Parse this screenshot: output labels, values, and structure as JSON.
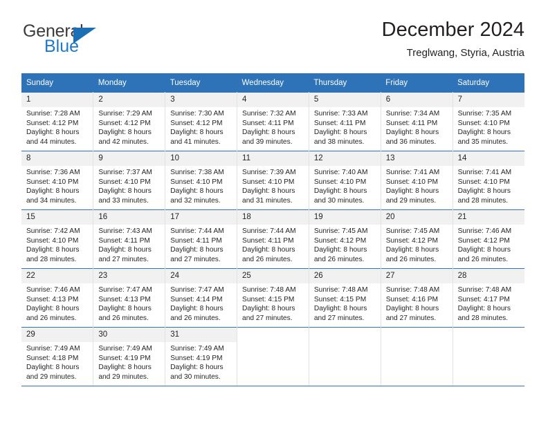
{
  "brand": {
    "name_top": "General",
    "name_bottom": "Blue",
    "triangle_color": "#1b6fb5",
    "text_color": "#3b3b3b",
    "blue_color": "#2079c8"
  },
  "header": {
    "title": "December 2024",
    "subtitle": "Treglwang, Styria, Austria"
  },
  "theme": {
    "header_bg": "#2e72b8",
    "header_text": "#ffffff",
    "daynum_bg": "#f1f1f1",
    "cell_border": "#e2e2e2",
    "week_border": "#2e72b8",
    "text": "#231f20"
  },
  "weekday_headers": [
    "Sunday",
    "Monday",
    "Tuesday",
    "Wednesday",
    "Thursday",
    "Friday",
    "Saturday"
  ],
  "weeks": [
    [
      {
        "day": "1",
        "sunrise": "Sunrise: 7:28 AM",
        "sunset": "Sunset: 4:12 PM",
        "daylight_line1": "Daylight: 8 hours",
        "daylight_line2": "and 44 minutes."
      },
      {
        "day": "2",
        "sunrise": "Sunrise: 7:29 AM",
        "sunset": "Sunset: 4:12 PM",
        "daylight_line1": "Daylight: 8 hours",
        "daylight_line2": "and 42 minutes."
      },
      {
        "day": "3",
        "sunrise": "Sunrise: 7:30 AM",
        "sunset": "Sunset: 4:12 PM",
        "daylight_line1": "Daylight: 8 hours",
        "daylight_line2": "and 41 minutes."
      },
      {
        "day": "4",
        "sunrise": "Sunrise: 7:32 AM",
        "sunset": "Sunset: 4:11 PM",
        "daylight_line1": "Daylight: 8 hours",
        "daylight_line2": "and 39 minutes."
      },
      {
        "day": "5",
        "sunrise": "Sunrise: 7:33 AM",
        "sunset": "Sunset: 4:11 PM",
        "daylight_line1": "Daylight: 8 hours",
        "daylight_line2": "and 38 minutes."
      },
      {
        "day": "6",
        "sunrise": "Sunrise: 7:34 AM",
        "sunset": "Sunset: 4:11 PM",
        "daylight_line1": "Daylight: 8 hours",
        "daylight_line2": "and 36 minutes."
      },
      {
        "day": "7",
        "sunrise": "Sunrise: 7:35 AM",
        "sunset": "Sunset: 4:10 PM",
        "daylight_line1": "Daylight: 8 hours",
        "daylight_line2": "and 35 minutes."
      }
    ],
    [
      {
        "day": "8",
        "sunrise": "Sunrise: 7:36 AM",
        "sunset": "Sunset: 4:10 PM",
        "daylight_line1": "Daylight: 8 hours",
        "daylight_line2": "and 34 minutes."
      },
      {
        "day": "9",
        "sunrise": "Sunrise: 7:37 AM",
        "sunset": "Sunset: 4:10 PM",
        "daylight_line1": "Daylight: 8 hours",
        "daylight_line2": "and 33 minutes."
      },
      {
        "day": "10",
        "sunrise": "Sunrise: 7:38 AM",
        "sunset": "Sunset: 4:10 PM",
        "daylight_line1": "Daylight: 8 hours",
        "daylight_line2": "and 32 minutes."
      },
      {
        "day": "11",
        "sunrise": "Sunrise: 7:39 AM",
        "sunset": "Sunset: 4:10 PM",
        "daylight_line1": "Daylight: 8 hours",
        "daylight_line2": "and 31 minutes."
      },
      {
        "day": "12",
        "sunrise": "Sunrise: 7:40 AM",
        "sunset": "Sunset: 4:10 PM",
        "daylight_line1": "Daylight: 8 hours",
        "daylight_line2": "and 30 minutes."
      },
      {
        "day": "13",
        "sunrise": "Sunrise: 7:41 AM",
        "sunset": "Sunset: 4:10 PM",
        "daylight_line1": "Daylight: 8 hours",
        "daylight_line2": "and 29 minutes."
      },
      {
        "day": "14",
        "sunrise": "Sunrise: 7:41 AM",
        "sunset": "Sunset: 4:10 PM",
        "daylight_line1": "Daylight: 8 hours",
        "daylight_line2": "and 28 minutes."
      }
    ],
    [
      {
        "day": "15",
        "sunrise": "Sunrise: 7:42 AM",
        "sunset": "Sunset: 4:10 PM",
        "daylight_line1": "Daylight: 8 hours",
        "daylight_line2": "and 28 minutes."
      },
      {
        "day": "16",
        "sunrise": "Sunrise: 7:43 AM",
        "sunset": "Sunset: 4:11 PM",
        "daylight_line1": "Daylight: 8 hours",
        "daylight_line2": "and 27 minutes."
      },
      {
        "day": "17",
        "sunrise": "Sunrise: 7:44 AM",
        "sunset": "Sunset: 4:11 PM",
        "daylight_line1": "Daylight: 8 hours",
        "daylight_line2": "and 27 minutes."
      },
      {
        "day": "18",
        "sunrise": "Sunrise: 7:44 AM",
        "sunset": "Sunset: 4:11 PM",
        "daylight_line1": "Daylight: 8 hours",
        "daylight_line2": "and 26 minutes."
      },
      {
        "day": "19",
        "sunrise": "Sunrise: 7:45 AM",
        "sunset": "Sunset: 4:12 PM",
        "daylight_line1": "Daylight: 8 hours",
        "daylight_line2": "and 26 minutes."
      },
      {
        "day": "20",
        "sunrise": "Sunrise: 7:45 AM",
        "sunset": "Sunset: 4:12 PM",
        "daylight_line1": "Daylight: 8 hours",
        "daylight_line2": "and 26 minutes."
      },
      {
        "day": "21",
        "sunrise": "Sunrise: 7:46 AM",
        "sunset": "Sunset: 4:12 PM",
        "daylight_line1": "Daylight: 8 hours",
        "daylight_line2": "and 26 minutes."
      }
    ],
    [
      {
        "day": "22",
        "sunrise": "Sunrise: 7:46 AM",
        "sunset": "Sunset: 4:13 PM",
        "daylight_line1": "Daylight: 8 hours",
        "daylight_line2": "and 26 minutes."
      },
      {
        "day": "23",
        "sunrise": "Sunrise: 7:47 AM",
        "sunset": "Sunset: 4:13 PM",
        "daylight_line1": "Daylight: 8 hours",
        "daylight_line2": "and 26 minutes."
      },
      {
        "day": "24",
        "sunrise": "Sunrise: 7:47 AM",
        "sunset": "Sunset: 4:14 PM",
        "daylight_line1": "Daylight: 8 hours",
        "daylight_line2": "and 26 minutes."
      },
      {
        "day": "25",
        "sunrise": "Sunrise: 7:48 AM",
        "sunset": "Sunset: 4:15 PM",
        "daylight_line1": "Daylight: 8 hours",
        "daylight_line2": "and 27 minutes."
      },
      {
        "day": "26",
        "sunrise": "Sunrise: 7:48 AM",
        "sunset": "Sunset: 4:15 PM",
        "daylight_line1": "Daylight: 8 hours",
        "daylight_line2": "and 27 minutes."
      },
      {
        "day": "27",
        "sunrise": "Sunrise: 7:48 AM",
        "sunset": "Sunset: 4:16 PM",
        "daylight_line1": "Daylight: 8 hours",
        "daylight_line2": "and 27 minutes."
      },
      {
        "day": "28",
        "sunrise": "Sunrise: 7:48 AM",
        "sunset": "Sunset: 4:17 PM",
        "daylight_line1": "Daylight: 8 hours",
        "daylight_line2": "and 28 minutes."
      }
    ],
    [
      {
        "day": "29",
        "sunrise": "Sunrise: 7:49 AM",
        "sunset": "Sunset: 4:18 PM",
        "daylight_line1": "Daylight: 8 hours",
        "daylight_line2": "and 29 minutes."
      },
      {
        "day": "30",
        "sunrise": "Sunrise: 7:49 AM",
        "sunset": "Sunset: 4:19 PM",
        "daylight_line1": "Daylight: 8 hours",
        "daylight_line2": "and 29 minutes."
      },
      {
        "day": "31",
        "sunrise": "Sunrise: 7:49 AM",
        "sunset": "Sunset: 4:19 PM",
        "daylight_line1": "Daylight: 8 hours",
        "daylight_line2": "and 30 minutes."
      },
      {
        "day": "",
        "sunrise": "",
        "sunset": "",
        "daylight_line1": "",
        "daylight_line2": ""
      },
      {
        "day": "",
        "sunrise": "",
        "sunset": "",
        "daylight_line1": "",
        "daylight_line2": ""
      },
      {
        "day": "",
        "sunrise": "",
        "sunset": "",
        "daylight_line1": "",
        "daylight_line2": ""
      },
      {
        "day": "",
        "sunrise": "",
        "sunset": "",
        "daylight_line1": "",
        "daylight_line2": ""
      }
    ]
  ]
}
